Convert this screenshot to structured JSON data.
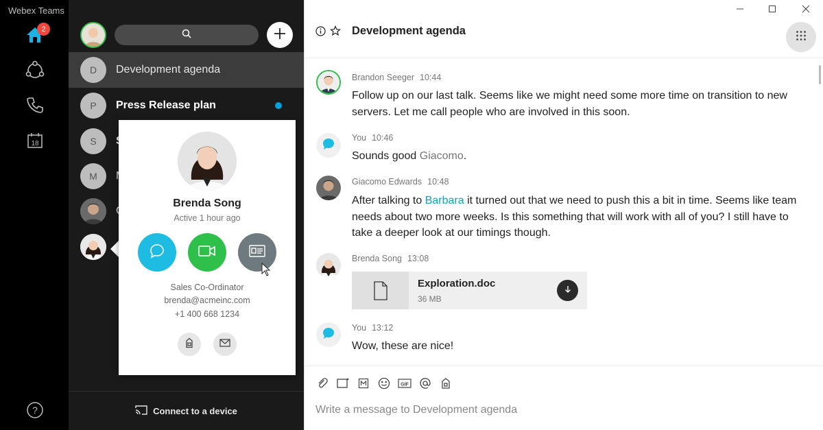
{
  "app": {
    "title": "Webex Teams",
    "badge_count": "2",
    "accent": "#00a0e0"
  },
  "rail": {
    "items": [
      {
        "name": "home-icon"
      },
      {
        "name": "teams-icon"
      },
      {
        "name": "phone-icon"
      },
      {
        "name": "calendar-icon",
        "label": "18"
      }
    ],
    "help_icon": "question-icon"
  },
  "list": {
    "rows": [
      {
        "initial": "D",
        "name": "Development agenda",
        "active": true
      },
      {
        "initial": "P",
        "name": "Press Release plan",
        "unread": true
      },
      {
        "initial": "S",
        "name": "S"
      },
      {
        "initial": "M",
        "name": "M"
      },
      {
        "initial": "",
        "name": "G"
      },
      {
        "initial": "",
        "name": ""
      }
    ],
    "connect_label": "Connect to a device"
  },
  "card": {
    "name": "Brenda Song",
    "status": "Active 1 hour ago",
    "title": "Sales Co-Ordinator",
    "email": "brenda@acmeinc.com",
    "phone": "+1 400 668 1234",
    "colors": {
      "message": "#1ebbe3",
      "video": "#2fbf4b",
      "contact": "#6e7a7e"
    }
  },
  "main": {
    "space_title": "Development agenda",
    "messages": [
      {
        "sender": "Brandon Seeger",
        "time": "10:44",
        "text": "Follow up on our last talk. Seems like we might need some more time on transition to new servers. Let me call people who are involved in this soon."
      },
      {
        "sender": "You",
        "time": "10:46",
        "text_pre": "Sounds good ",
        "mention": "Giacomo",
        "text_post": "."
      },
      {
        "sender": "Giacomo Edwards",
        "time": "10:48",
        "text_pre": "After talking to ",
        "mention": "Barbara",
        "text_post": " it turned out that we need to push this a bit in time. Seems like team needs about two more weeks. Is this something that will work with all of you? I still have to take a deeper look at our timings though."
      },
      {
        "sender": "Brenda Song",
        "time": "13:08",
        "file": {
          "name": "Exploration.doc",
          "size": "36 MB"
        }
      },
      {
        "sender": "You",
        "time": "13:12",
        "text": "Wow, these are nice!"
      }
    ],
    "composer_placeholder": "Write a message to Development agenda"
  }
}
